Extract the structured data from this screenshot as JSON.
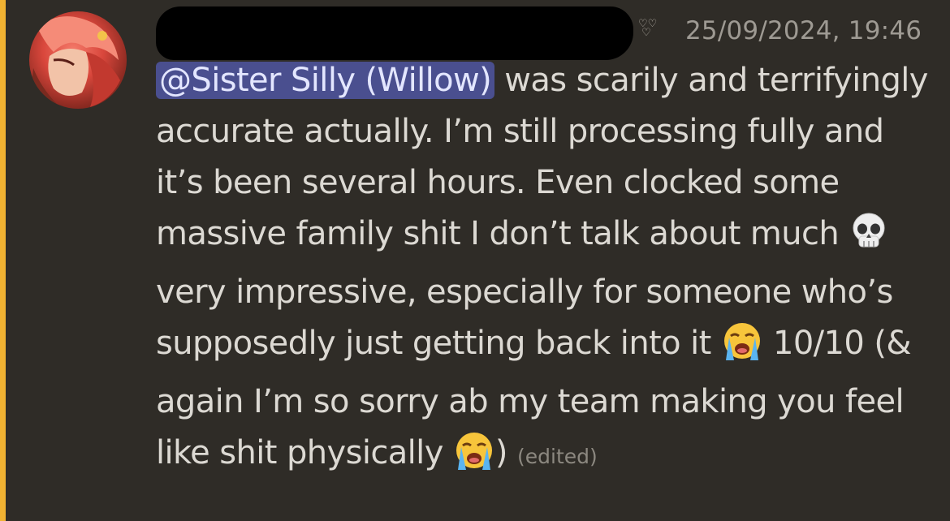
{
  "message": {
    "author_name_redacted": true,
    "timestamp": "25/09/2024, 19:46",
    "mention": "@Sister Silly (Willow)",
    "segments": {
      "s1": " was scarily and terrifyingly accurate actually. I’m still processing fully and it’s been several hours. Even clocked some massive family shit I don’t talk about much ",
      "s2": " very impressive, especially for someone who’s supposedly just getting back into it ",
      "s3": " 10/10 (& again I’m so sorry ab my team making you feel like shit physically ",
      "s4": ")"
    },
    "edited_label": "(edited)",
    "emojis": [
      "skull-icon",
      "loudly-crying-face-icon",
      "loudly-crying-face-icon"
    ]
  },
  "colors": {
    "background": "#2f2c27",
    "accent_bar": "#f0b232",
    "mention_bg": "#4a4f8f",
    "text": "#dcd9d3",
    "timestamp": "#9e9a93"
  }
}
